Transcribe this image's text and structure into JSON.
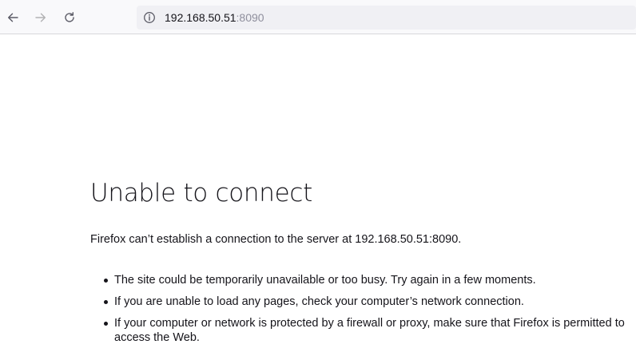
{
  "toolbar": {
    "url_host": "192.168.50.51",
    "url_port": ":8090",
    "icons": {
      "back": "back-arrow-icon",
      "forward": "forward-arrow-icon",
      "reload": "reload-icon",
      "info": "info-icon"
    }
  },
  "error": {
    "title": "Unable to connect",
    "description": "Firefox can’t establish a connection to the server at 192.168.50.51:8090.",
    "bullets": [
      "The site could be temporarily unavailable or too busy. Try again in a few moments.",
      "If you are unable to load any pages, check your computer’s network connection.",
      "If your computer or network is protected by a firewall or proxy, make sure that Firefox is permitted to access the Web."
    ]
  },
  "colors": {
    "text": "#15141a",
    "toolbar_bg": "#f9f9fb",
    "urlbar_bg": "#f0f0f4",
    "port_text": "#8f8f9d"
  }
}
